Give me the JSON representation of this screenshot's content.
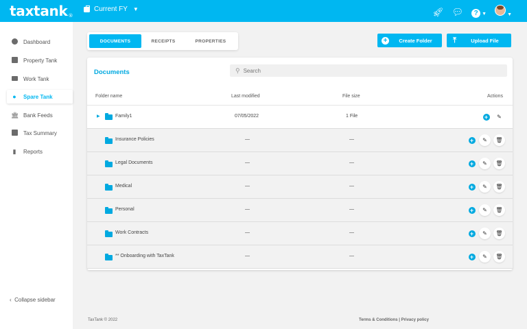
{
  "app": {
    "logo": "taxtank",
    "logo_mark": "®",
    "fy_label": "Current FY"
  },
  "sidebar": {
    "items": [
      {
        "label": "Dashboard",
        "icon": "dashboard-icon"
      },
      {
        "label": "Property Tank",
        "icon": "property-icon"
      },
      {
        "label": "Work Tank",
        "icon": "briefcase-icon"
      },
      {
        "label": "Spare Tank",
        "icon": "spare-icon",
        "active": true
      },
      {
        "label": "Bank Feeds",
        "icon": "bank-icon"
      },
      {
        "label": "Tax Summary",
        "icon": "tax-icon"
      },
      {
        "label": "Reports",
        "icon": "reports-icon"
      }
    ],
    "collapse_label": "Collapse sidebar"
  },
  "tabs": [
    "DOCUMENTS",
    "RECEIPTS",
    "PROPERTIES"
  ],
  "actions": {
    "create_folder": "Create Folder",
    "upload_file": "Upload File"
  },
  "documents": {
    "title": "Documents",
    "search_placeholder": "Search",
    "columns": {
      "name": "Folder name",
      "modified": "Last modified",
      "size": "File size",
      "actions": "Actions"
    },
    "rows": [
      {
        "name": "Family1",
        "modified": "07/05/2022",
        "size": "1 File"
      },
      {
        "name": "Insurance Policies",
        "modified": "—",
        "size": "—"
      },
      {
        "name": "Legal Documents",
        "modified": "—",
        "size": "—"
      },
      {
        "name": "Medical",
        "modified": "—",
        "size": "—"
      },
      {
        "name": "Personal",
        "modified": "—",
        "size": "—"
      },
      {
        "name": "Work Contracts",
        "modified": "—",
        "size": "—"
      },
      {
        "name": "** Onboarding with TaxTank",
        "modified": "—",
        "size": "—"
      }
    ]
  },
  "footer": {
    "copyright": "TaxTank © 2022",
    "links": "Terms & Conditions | Privacy policy"
  },
  "colors": {
    "brand": "#00b7f1",
    "accent_text": "#00a9e0"
  }
}
